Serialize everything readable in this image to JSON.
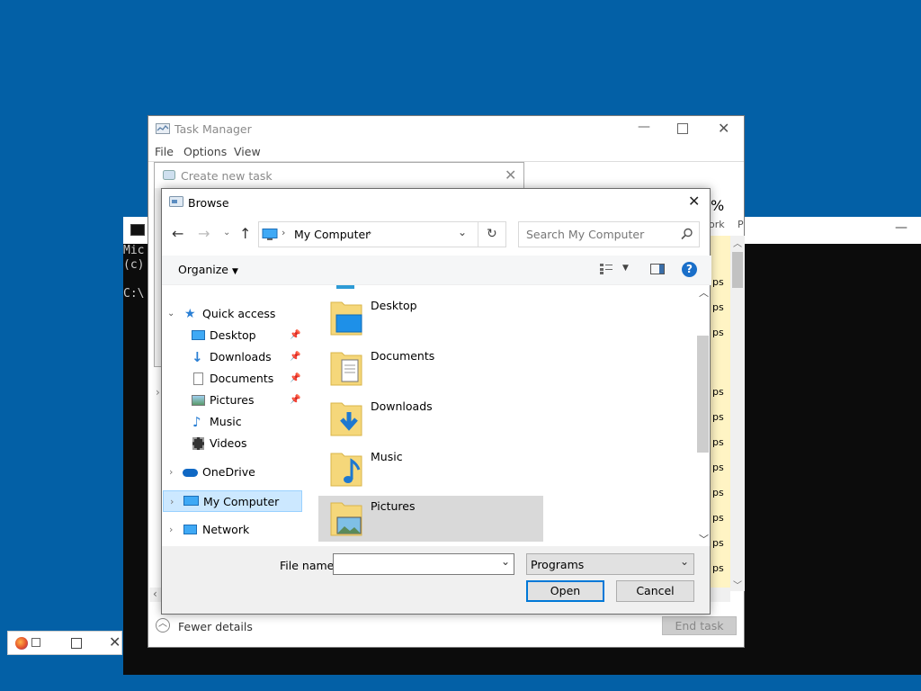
{
  "console": {
    "lines": [
      "Mic",
      "(c)",
      "",
      "C:\\"
    ]
  },
  "task_manager": {
    "title": "Task Manager",
    "menu": [
      "File",
      "Options",
      "View"
    ],
    "columns_visible": [
      "%",
      "ork",
      "P"
    ],
    "row_text": "ps",
    "footer": {
      "fewer_details": "Fewer details",
      "end_task": "End task"
    }
  },
  "create_new_task": {
    "title": "Create new task"
  },
  "browse": {
    "title": "Browse",
    "address": {
      "location": "My Computer"
    },
    "search": {
      "placeholder": "Search My Computer"
    },
    "toolbar": {
      "organize": "Organize"
    },
    "nav_tree": {
      "quick_access": "Quick access",
      "items": [
        {
          "label": "Desktop",
          "pinned": true
        },
        {
          "label": "Downloads",
          "pinned": true
        },
        {
          "label": "Documents",
          "pinned": true
        },
        {
          "label": "Pictures",
          "pinned": true
        },
        {
          "label": "Music",
          "pinned": false
        },
        {
          "label": "Videos",
          "pinned": false
        }
      ],
      "onedrive": "OneDrive",
      "my_computer": "My Computer",
      "network": "Network"
    },
    "folders": [
      "Desktop",
      "Documents",
      "Downloads",
      "Music",
      "Pictures"
    ],
    "file_name_label": "File name:",
    "file_name_value": "",
    "file_type": "Programs",
    "open_label": "Open",
    "cancel_label": "Cancel"
  },
  "taskbar_app": {
    "name": "firefox"
  },
  "colors": {
    "desktop": "#0360a6",
    "selection": "#cce8ff",
    "folder_selected": "#d9d9d9",
    "help_blue": "#1a6fc9"
  }
}
